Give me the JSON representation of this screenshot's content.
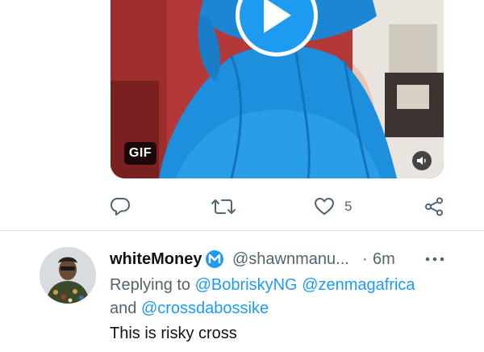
{
  "media": {
    "badge": "GIF"
  },
  "actions": {
    "like_count": "5"
  },
  "reply_tweet": {
    "display_name": "whiteMoney",
    "handle": "@shawnmanu...",
    "separator": "·",
    "time": "6m",
    "replying_to_label": "Replying to",
    "mentions": [
      "@BobriskyNG",
      "@zenmagafrica",
      "@crossdabossike"
    ],
    "and_label": "and",
    "text": "This is risky cross"
  },
  "colors": {
    "accent": "#1d9bf0",
    "secondary_text": "#536471",
    "primary_text": "#0f1419",
    "verified_badge": "#1d9bf0",
    "dress": "#1e8fdd"
  },
  "icons": {
    "play": "play-icon",
    "mute": "volume-icon",
    "reply": "reply-icon",
    "retweet": "retweet-icon",
    "like": "heart-icon",
    "share": "share-icon",
    "more": "more-icon",
    "verified": "verified-badge-icon"
  }
}
